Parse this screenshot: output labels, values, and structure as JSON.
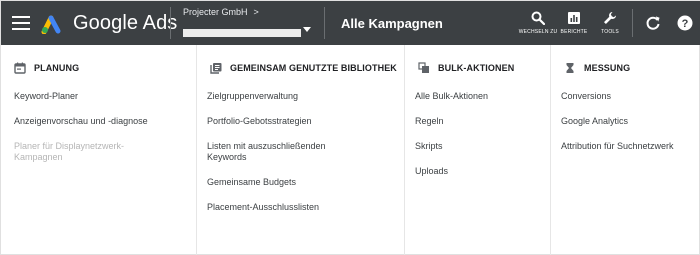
{
  "header": {
    "logo_text": "Google Ads",
    "account_name": "Projecter GmbH",
    "account_chevron": ">",
    "campaign_title": "Alle Kampagnen",
    "tools": [
      {
        "icon": "search-icon",
        "label": "WECHSELN ZU"
      },
      {
        "icon": "reports-icon",
        "label": "BERICHTE"
      },
      {
        "icon": "wrench-icon",
        "label": "TOOLS"
      }
    ],
    "refresh_icon": "refresh-icon",
    "help_icon": "help-icon"
  },
  "columns": [
    {
      "icon": "calendar-icon",
      "title": "PLANUNG",
      "items": [
        {
          "label": "Keyword-Planer",
          "disabled": false
        },
        {
          "label": "Anzeigenvorschau und -diagnose",
          "disabled": false
        },
        {
          "label": "Planer für Displaynetzwerk-Kampagnen",
          "disabled": true
        }
      ]
    },
    {
      "icon": "library-icon",
      "title": "GEMEINSAM GENUTZTE BIBLIOTHEK",
      "items": [
        {
          "label": "Zielgruppenverwaltung",
          "disabled": false
        },
        {
          "label": "Portfolio-Gebotsstrategien",
          "disabled": false
        },
        {
          "label": "Listen mit auszuschließenden Keywords",
          "disabled": false
        },
        {
          "label": "Gemeinsame Budgets",
          "disabled": false
        },
        {
          "label": "Placement-Ausschlusslisten",
          "disabled": false
        }
      ]
    },
    {
      "icon": "bulk-actions-icon",
      "title": "BULK-AKTIONEN",
      "items": [
        {
          "label": "Alle Bulk-Aktionen",
          "disabled": false
        },
        {
          "label": "Regeln",
          "disabled": false
        },
        {
          "label": "Skripts",
          "disabled": false
        },
        {
          "label": "Uploads",
          "disabled": false
        }
      ]
    },
    {
      "icon": "hourglass-icon",
      "title": "MESSUNG",
      "items": [
        {
          "label": "Conversions",
          "disabled": false
        },
        {
          "label": "Google Analytics",
          "disabled": false
        },
        {
          "label": "Attribution für Suchnetzwerk",
          "disabled": false
        }
      ]
    }
  ],
  "colors": {
    "header_bg": "#3c4043",
    "logo_blue": "#4285f4",
    "logo_yellow": "#fbbc04",
    "logo_green": "#34a853",
    "disabled_text": "#b5b5b5"
  }
}
